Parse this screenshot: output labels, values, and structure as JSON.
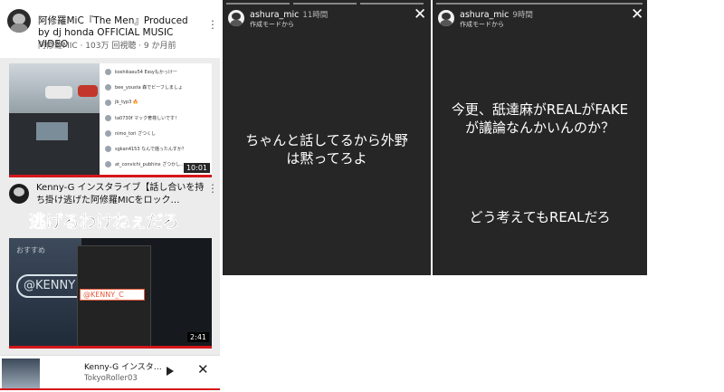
{
  "youtube": {
    "video1": {
      "title": "阿修羅MiC『The Men』Produced by dj honda OFFICIAL MUSIC VIDEO",
      "meta": "阿修羅MIC · 103万 回視聴 · 9 か月前",
      "duration": "10:01",
      "comments": [
        "koshikasu54 Essyもかっけー",
        "bee_yousta 森でビーフしましょ",
        "jb_typ3 🔥",
        "ta0730f マック奢検しいです！",
        "nimo_tori ざつくし",
        "sgkan4153 なんで揺ったんすか？",
        "at_convichi_pubhins ざつかし…"
      ]
    },
    "video2": {
      "title": "Kenny-G インスタライブ【話し合いを持ち掛け逃げた阿修羅MICをロック…",
      "caption": "逃げるわけねぇだろ",
      "suggestion_label": "おすすめ",
      "handle": "@KENNY",
      "tag": "@KENNY_C",
      "duration": "2:41"
    },
    "miniplayer": {
      "title": "Kenny-G インスタ…",
      "channel": "TokyoRoller03"
    }
  },
  "stories": [
    {
      "username": "ashura_mic",
      "time": "11時間",
      "mode": "作成モードから",
      "message_lines": [
        "ちゃんと話してるから外野",
        "は黙ってろよ"
      ]
    },
    {
      "username": "ashura_mic",
      "time": "9時間",
      "mode": "作成モードから",
      "message_lines": [
        "今更、舐達麻がREALがFAKE",
        "が議論なんかいんのか？"
      ],
      "message2": "どう考えてもREALだろ"
    }
  ],
  "colors": {
    "youtube_red": "#d4161b",
    "story_bg": "#262626"
  }
}
